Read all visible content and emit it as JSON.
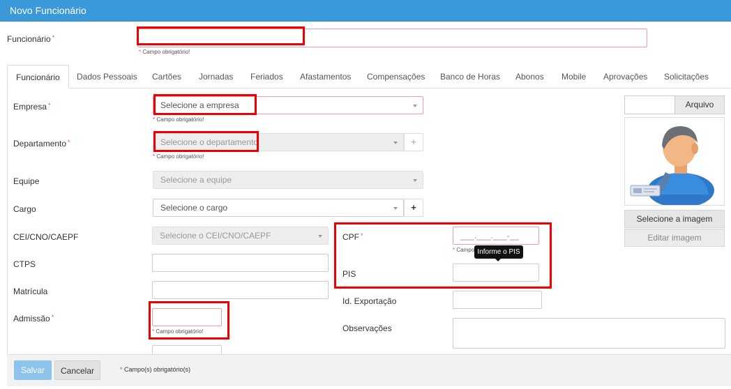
{
  "window": {
    "title": "Novo Funcionário"
  },
  "required_mark": "*",
  "funcionario": {
    "label": "Funcionário",
    "value": "",
    "hint": "Campo obrigatório!"
  },
  "tabs": [
    "Funcionário",
    "Dados Pessoais",
    "Cartões",
    "Jornadas",
    "Feriados",
    "Afastamentos",
    "Compensações",
    "Banco de Horas",
    "Abonos",
    "Mobile",
    "Aprovações",
    "Solicitações"
  ],
  "form": {
    "empresa": {
      "label": "Empresa",
      "placeholder": "Selecione a empresa",
      "hint": "Campo obrigatório!"
    },
    "departamento": {
      "label": "Departamento",
      "placeholder": "Selecione o departamento",
      "hint": "Campo obrigatório!",
      "add": "+"
    },
    "equipe": {
      "label": "Equipe",
      "placeholder": "Selecione a equipe"
    },
    "cargo": {
      "label": "Cargo",
      "placeholder": "Selecione o cargo",
      "add": "+"
    },
    "cei": {
      "label": "CEI/CNO/CAEPF",
      "placeholder": "Selecione o CEI/CNO/CAEPF"
    },
    "ctps": {
      "label": "CTPS",
      "value": ""
    },
    "matricula": {
      "label": "Matrícula",
      "value": ""
    },
    "admissao": {
      "label": "Admissão",
      "value": "",
      "hint": "Campo obrigatório!"
    },
    "cpf": {
      "label": "CPF",
      "mask": "___.___.___-__",
      "hint_visible": "Campo"
    },
    "pis": {
      "label": "PIS",
      "value": "",
      "tooltip": "Informe o PIS"
    },
    "id_exportacao": {
      "label": "Id. Exportação",
      "value": ""
    },
    "observacoes": {
      "label": "Observações",
      "value": ""
    }
  },
  "photo": {
    "file_button": "Arquivo",
    "select_image": "Selecione a imagem",
    "edit_image": "Editar imagem",
    "avatar_icon": "user-avatar-icon"
  },
  "footer": {
    "save": "Salvar",
    "cancel": "Cancelar",
    "note": "Campo(s) obrigatório(s)"
  },
  "colors": {
    "titlebar": "#3a9ad9",
    "highlight": "#ee0000",
    "required": "#d9534f",
    "save": "#8cc4ec"
  }
}
